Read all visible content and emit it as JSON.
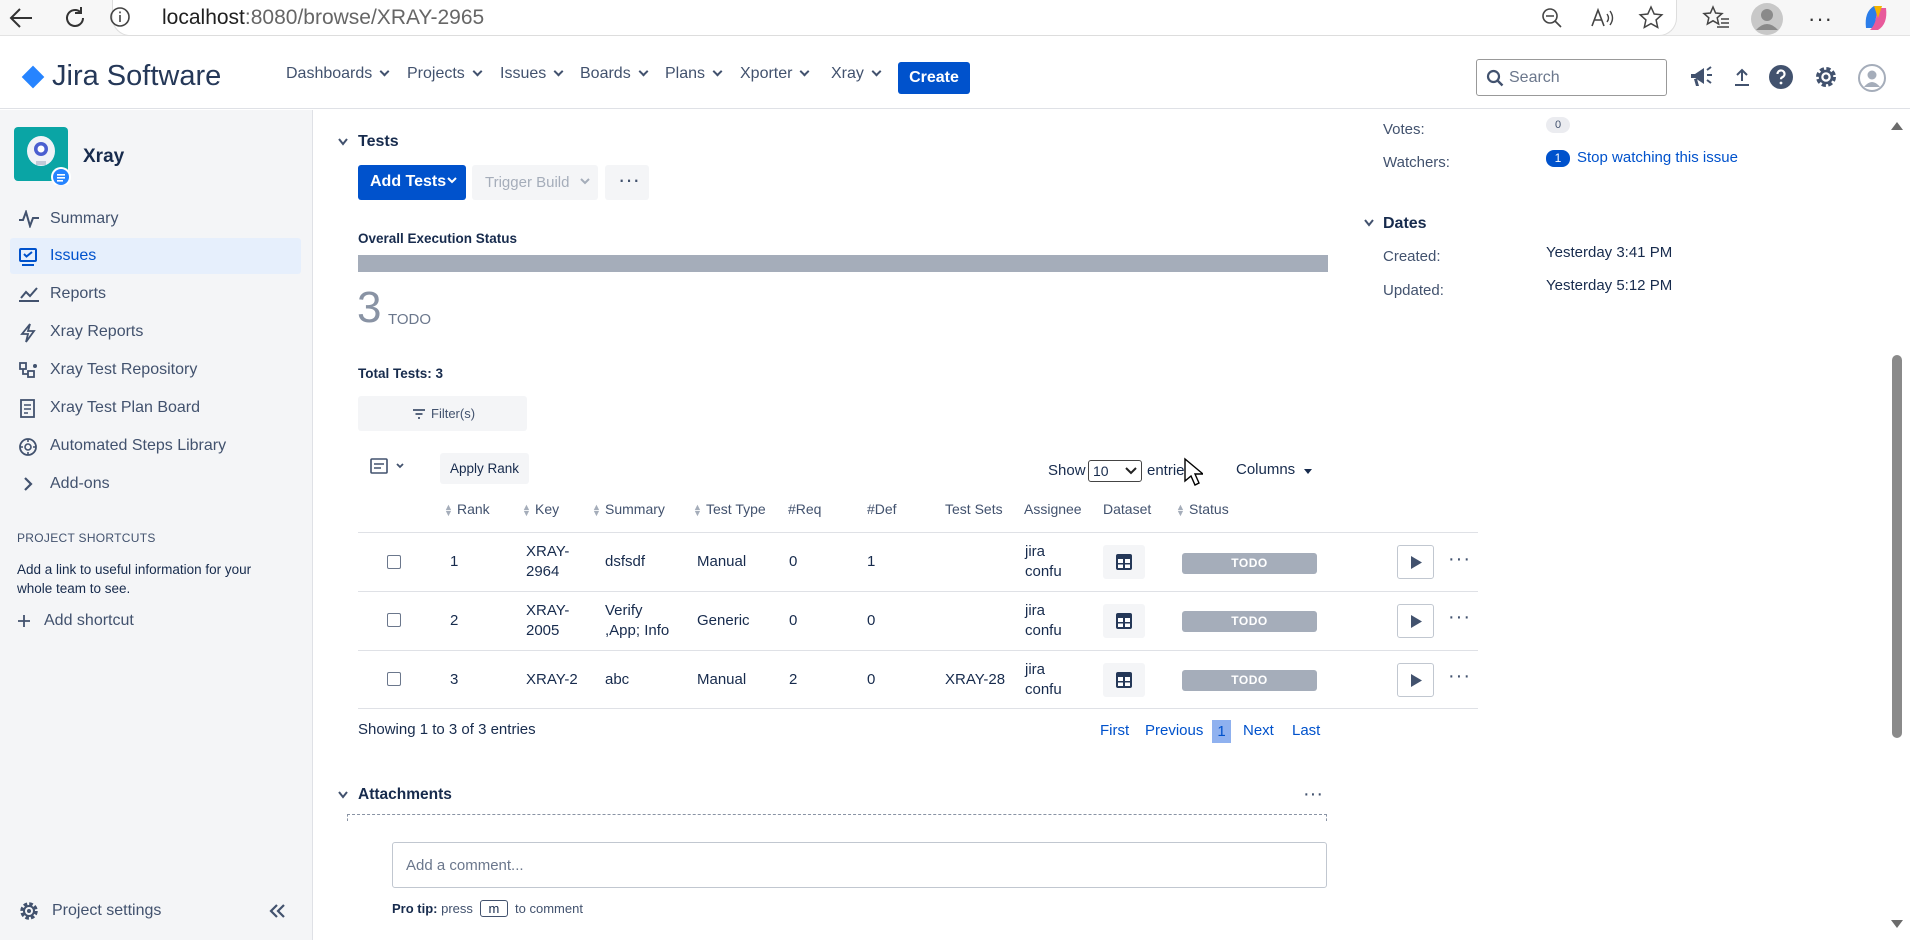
{
  "browser": {
    "url_host": "localhost",
    "url_path": ":8080/browse/XRAY-2965"
  },
  "header": {
    "logo_text": "Jira Software",
    "nav": [
      {
        "label": "Dashboards"
      },
      {
        "label": "Projects"
      },
      {
        "label": "Issues"
      },
      {
        "label": "Boards"
      },
      {
        "label": "Plans"
      },
      {
        "label": "Xporter"
      },
      {
        "label": "Xray"
      }
    ],
    "create_label": "Create",
    "search_placeholder": "Search"
  },
  "sidebar": {
    "project_name": "Xray",
    "items": [
      {
        "label": "Summary",
        "icon": "pulse-icon"
      },
      {
        "label": "Issues",
        "icon": "issues-icon"
      },
      {
        "label": "Reports",
        "icon": "chart-icon"
      },
      {
        "label": "Xray Reports",
        "icon": "lightning-icon"
      },
      {
        "label": "Xray Test Repository",
        "icon": "repository-icon"
      },
      {
        "label": "Xray Test Plan Board",
        "icon": "plan-board-icon"
      },
      {
        "label": "Automated Steps Library",
        "icon": "library-icon"
      },
      {
        "label": "Add-ons",
        "icon": "chevron-right-icon"
      }
    ],
    "shortcuts_heading": "PROJECT SHORTCUTS",
    "shortcuts_text": "Add a link to useful information for your whole team to see.",
    "add_shortcut": "Add shortcut",
    "settings": "Project settings"
  },
  "tests": {
    "section_title": "Tests",
    "add_tests": "Add Tests",
    "trigger_build": "Trigger Build",
    "overall_status_label": "Overall Execution Status",
    "count": "3",
    "count_status": "TODO",
    "total_tests": "Total Tests: 3",
    "filter_label": "Filter(s)",
    "apply_rank": "Apply Rank",
    "show_label": "Show",
    "show_value": "10",
    "entries_label": "entries",
    "columns_label": "Columns",
    "table": {
      "headers": [
        "Rank",
        "Key",
        "Summary",
        "Test Type",
        "#Req",
        "#Def",
        "Test Sets",
        "Assignee",
        "Dataset",
        "Status"
      ],
      "rows": [
        {
          "rank": "1",
          "key1": "XRAY-",
          "key2": "2964",
          "summary1": "dsfsdf",
          "summary2": "",
          "type": "Manual",
          "req": "0",
          "def": "1",
          "sets": "",
          "assignee1": "jira",
          "assignee2": "confu",
          "status": "TODO"
        },
        {
          "rank": "2",
          "key1": "XRAY-",
          "key2": "2005",
          "summary1": "Verify",
          "summary2": ",App; Info",
          "type": "Generic",
          "req": "0",
          "def": "0",
          "sets": "",
          "assignee1": "jira",
          "assignee2": "confu",
          "status": "TODO"
        },
        {
          "rank": "3",
          "key1": "XRAY-2",
          "key2": "",
          "summary1": "abc",
          "summary2": "",
          "type": "Manual",
          "req": "2",
          "def": "0",
          "sets": "XRAY-28",
          "assignee1": "jira",
          "assignee2": "confu",
          "status": "TODO"
        }
      ]
    },
    "showing": "Showing 1 to 3 of 3 entries",
    "pagination": {
      "first": "First",
      "previous": "Previous",
      "current": "1",
      "next": "Next",
      "last": "Last"
    }
  },
  "attachments": {
    "title": "Attachments"
  },
  "comment": {
    "placeholder": "Add a comment...",
    "protip_bold": "Pro tip:",
    "protip_press": "press",
    "protip_key": "m",
    "protip_rest": "to comment"
  },
  "people": {
    "votes_label": "Votes:",
    "votes_count": "0",
    "watchers_label": "Watchers:",
    "watchers_count": "1",
    "stop_watching": "Stop watching this issue"
  },
  "dates": {
    "title": "Dates",
    "created_label": "Created:",
    "created_value": "Yesterday 3:41 PM",
    "updated_label": "Updated:",
    "updated_value": "Yesterday 5:12 PM"
  }
}
